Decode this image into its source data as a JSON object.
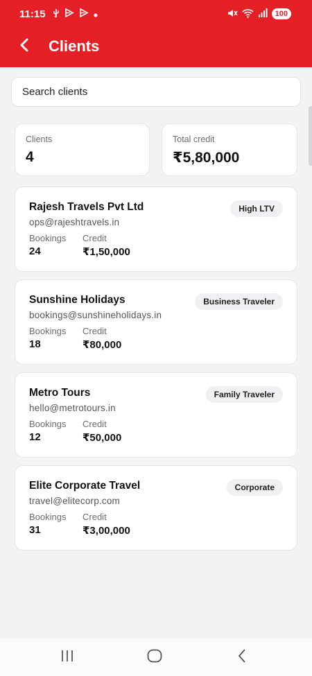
{
  "status": {
    "time": "11:15",
    "battery": "100"
  },
  "appbar": {
    "title": "Clients"
  },
  "search": {
    "placeholder": "Search clients",
    "value": ""
  },
  "stats": {
    "clients_label": "Clients",
    "clients_value": "4",
    "credit_label": "Total credit",
    "credit_value": "₹5,80,000"
  },
  "clients": [
    {
      "name": "Rajesh Travels Pvt Ltd",
      "email": "ops@rajeshtravels.in",
      "tag": "High LTV",
      "bookings_label": "Bookings",
      "bookings": "24",
      "credit_label": "Credit",
      "credit": "₹1,50,000"
    },
    {
      "name": "Sunshine Holidays",
      "email": "bookings@sunshineholidays.in",
      "tag": "Business Traveler",
      "bookings_label": "Bookings",
      "bookings": "18",
      "credit_label": "Credit",
      "credit": "₹80,000"
    },
    {
      "name": "Metro Tours",
      "email": "hello@metrotours.in",
      "tag": "Family Traveler",
      "bookings_label": "Bookings",
      "bookings": "12",
      "credit_label": "Credit",
      "credit": "₹50,000"
    },
    {
      "name": "Elite Corporate Travel",
      "email": "travel@elitecorp.com",
      "tag": "Corporate",
      "bookings_label": "Bookings",
      "bookings": "31",
      "credit_label": "Credit",
      "credit": "₹3,00,000"
    }
  ],
  "colors": {
    "brand": "#e41f26",
    "background": "#f4f4f5",
    "card": "#ffffff"
  }
}
